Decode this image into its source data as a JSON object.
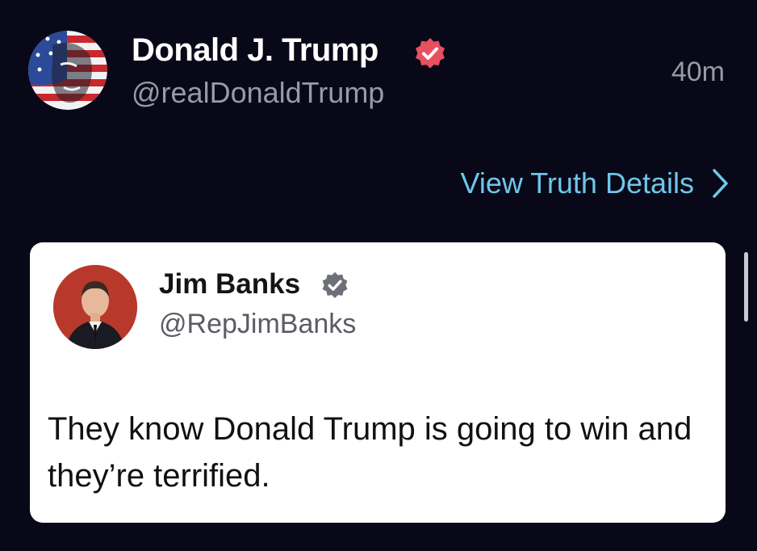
{
  "post": {
    "author_name": "Donald J. Trump",
    "author_handle": "@realDonaldTrump",
    "timestamp": "40m",
    "details_link_label": "View Truth Details"
  },
  "quoted_post": {
    "author_name": "Jim Banks",
    "author_handle": "@RepJimBanks",
    "text": "They know Donald Trump is going to win and they’re terrified."
  },
  "icons": {
    "author_verified": "verified-badge-red",
    "quoted_verified": "verified-badge-grey",
    "details_chevron": "chevron-right-icon"
  },
  "colors": {
    "background": "#080818",
    "link": "#6ec6ea",
    "verified_red": "#e6505f",
    "verified_grey": "#6e7078",
    "card": "#ffffff"
  }
}
